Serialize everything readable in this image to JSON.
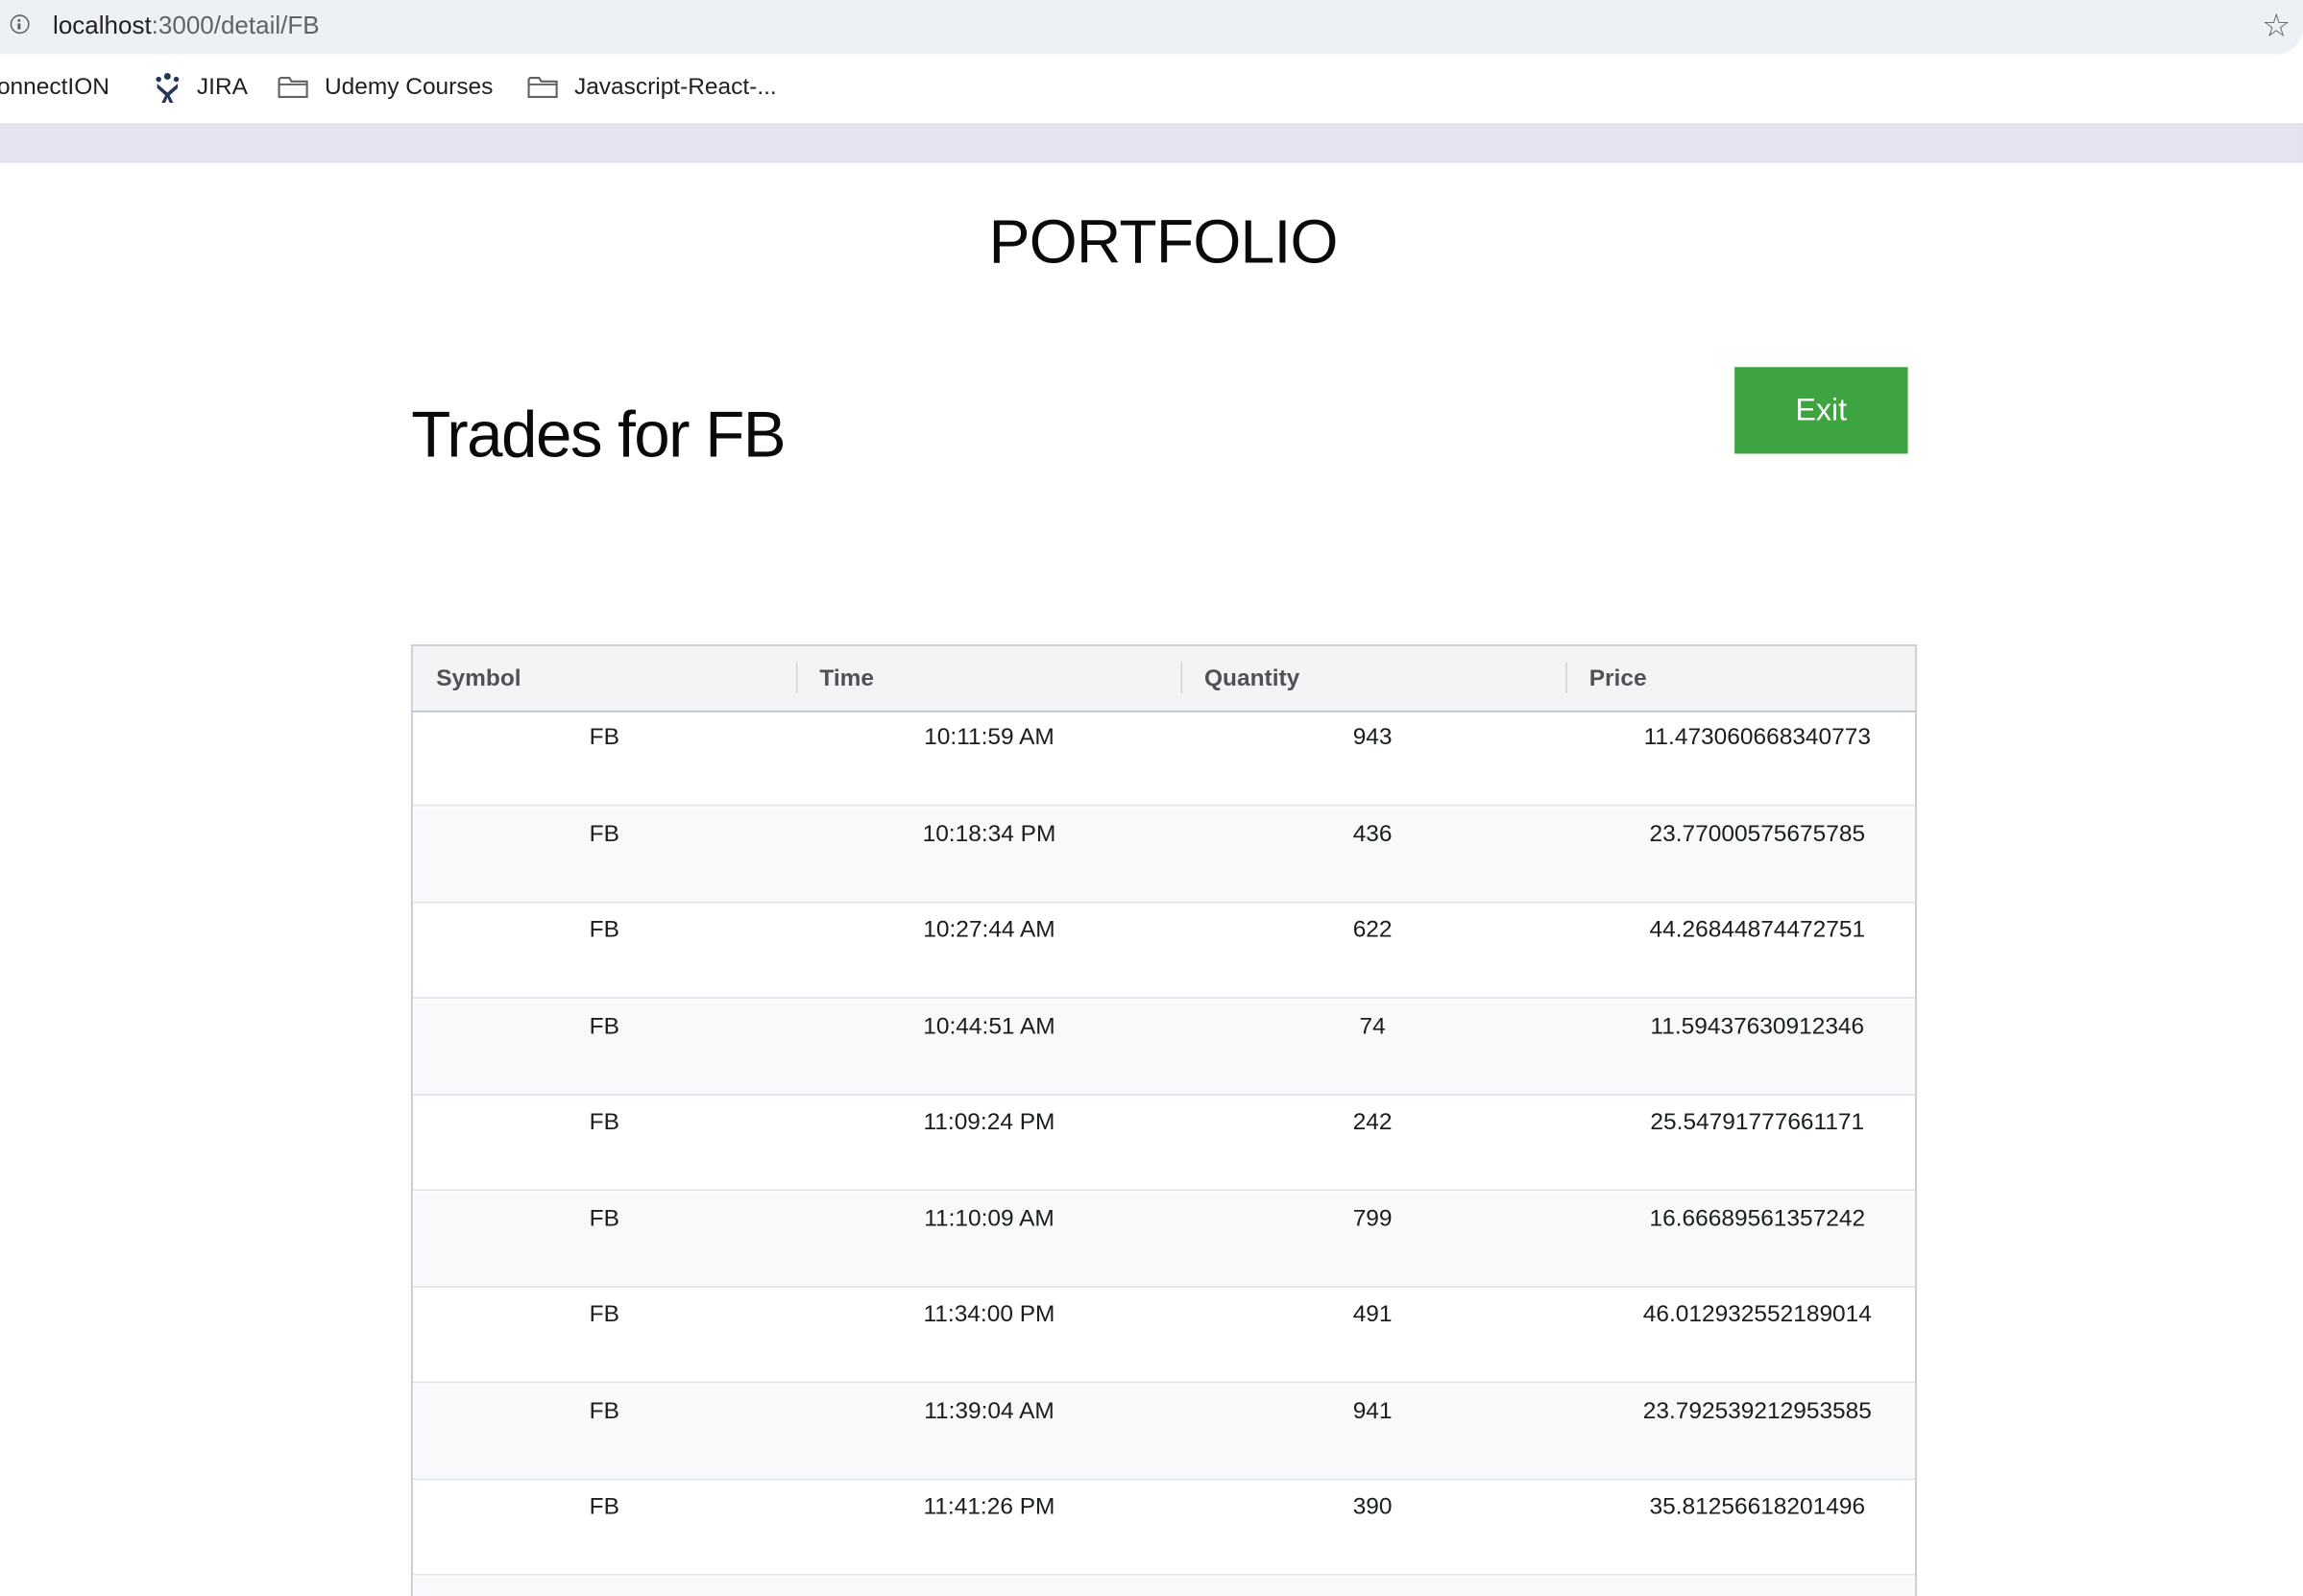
{
  "browser": {
    "url_host": "localhost",
    "url_path": ":3000/detail/FB",
    "bookmarks": [
      {
        "label": "onnectION",
        "icon": "none"
      },
      {
        "label": "JIRA",
        "icon": "jira-icon"
      },
      {
        "label": "Udemy Courses",
        "icon": "folder-icon"
      },
      {
        "label": "Javascript-React-...",
        "icon": "folder-icon"
      }
    ]
  },
  "page": {
    "app_title": "PORTFOLIO",
    "heading": "Trades for FB",
    "exit_label": "Exit",
    "accent_color": "#3ea441"
  },
  "table": {
    "columns": [
      "Symbol",
      "Time",
      "Quantity",
      "Price"
    ],
    "rows": [
      [
        "FB",
        "10:11:59 AM",
        "943",
        "11.473060668340773"
      ],
      [
        "FB",
        "10:18:34 PM",
        "436",
        "23.77000575675785"
      ],
      [
        "FB",
        "10:27:44 AM",
        "622",
        "44.26844874472751"
      ],
      [
        "FB",
        "10:44:51 AM",
        "74",
        "11.59437630912346"
      ],
      [
        "FB",
        "11:09:24 PM",
        "242",
        "25.54791777661171"
      ],
      [
        "FB",
        "11:10:09 AM",
        "799",
        "16.66689561357242"
      ],
      [
        "FB",
        "11:34:00 PM",
        "491",
        "46.012932552189014"
      ],
      [
        "FB",
        "11:39:04 AM",
        "941",
        "23.792539212953585"
      ],
      [
        "FB",
        "11:41:26 PM",
        "390",
        "35.81256618201496"
      ]
    ]
  }
}
